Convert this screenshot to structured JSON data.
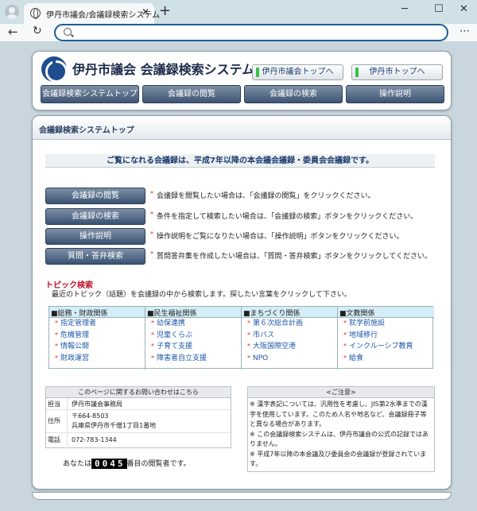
{
  "browser": {
    "tab_title": "伊丹市議会/会議録検索システム",
    "tab_close": "✕",
    "new_tab": "+",
    "minimize": "─",
    "maximize": "☐",
    "close": "✕",
    "back": "←",
    "reload": "↻",
    "menu": "⋯",
    "address_placeholder": ""
  },
  "header": {
    "site_title": "伊丹市議会 会議録検索システム",
    "link_council_top": "伊丹市議会トップへ",
    "link_city_top": "伊丹市トップへ",
    "nav": [
      "会議録検索システムトップ",
      "会議録の閲覧",
      "会議録の検索",
      "操作説明"
    ]
  },
  "page": {
    "section_title": "会議録検索システムトップ",
    "notice": "ご覧になれる会議録は、平成7年以降の本会議会議録・委員会会議録です。",
    "actions": [
      {
        "label": "会議録の閲覧",
        "desc": "会議録を閲覧したい場合は、「会議録の閲覧」をクリックください。"
      },
      {
        "label": "会議録の検索",
        "desc": "条件を指定して検索したい場合は、「会議録の検索」ボタンをクリックください。"
      },
      {
        "label": "操作説明",
        "desc": "操作説明をご覧になりたい場合は、「操作説明」ボタンをクリックください。"
      },
      {
        "label": "質問・答弁検索",
        "desc": "質問答弁集を作成したい場合は、「質問・答弁検索」ボタンをクリックしてください。"
      }
    ],
    "topic_heading": "トピック検索",
    "topic_desc": "最近のトピック（話題）を会議録の中から検索します。探したい言葉をクリックして下さい。",
    "topic_columns": [
      {
        "head": "■総務・財政関係",
        "items": [
          "指定管理者",
          "危機管理",
          "情報公開",
          "財政運営"
        ]
      },
      {
        "head": "■民生福祉関係",
        "items": [
          "幼保連携",
          "児童くらぶ",
          "子育て支援",
          "障害者自立支援"
        ]
      },
      {
        "head": "■まちづくり関係",
        "items": [
          "第６次総合計画",
          "市バス",
          "大阪国際空港",
          "NPO"
        ]
      },
      {
        "head": "■文教関係",
        "items": [
          "就学前施設",
          "地域移行",
          "インクルーシブ教育",
          "給食"
        ]
      }
    ],
    "contact": {
      "heading": "このページに関するお問い合わせはこちら",
      "label_person": "担当",
      "person": "伊丹市議会事務局",
      "label_address": "住所",
      "postal": "〒664-8503",
      "address": "兵庫県伊丹市千僧1丁目1番地",
      "label_phone": "電話",
      "phone": "072-783-1344"
    },
    "caution": {
      "heading": "<ご注意>",
      "text": "※ 漢字表記については、汎用性を考慮し、JIS第2水準までの漢字を使用しています。このため人名や地名など、会議録冊子等と異なる場合があります。\n※ この会議録検索システムは、伊丹市議会の公式の記録ではありません。\n※ 平成7年以降の本会議及び委員会の会議録が登録されています。"
    },
    "counter_prefix": "あなたは",
    "counter_value": "0045",
    "counter_suffix": "番目の閲覧者です。"
  }
}
